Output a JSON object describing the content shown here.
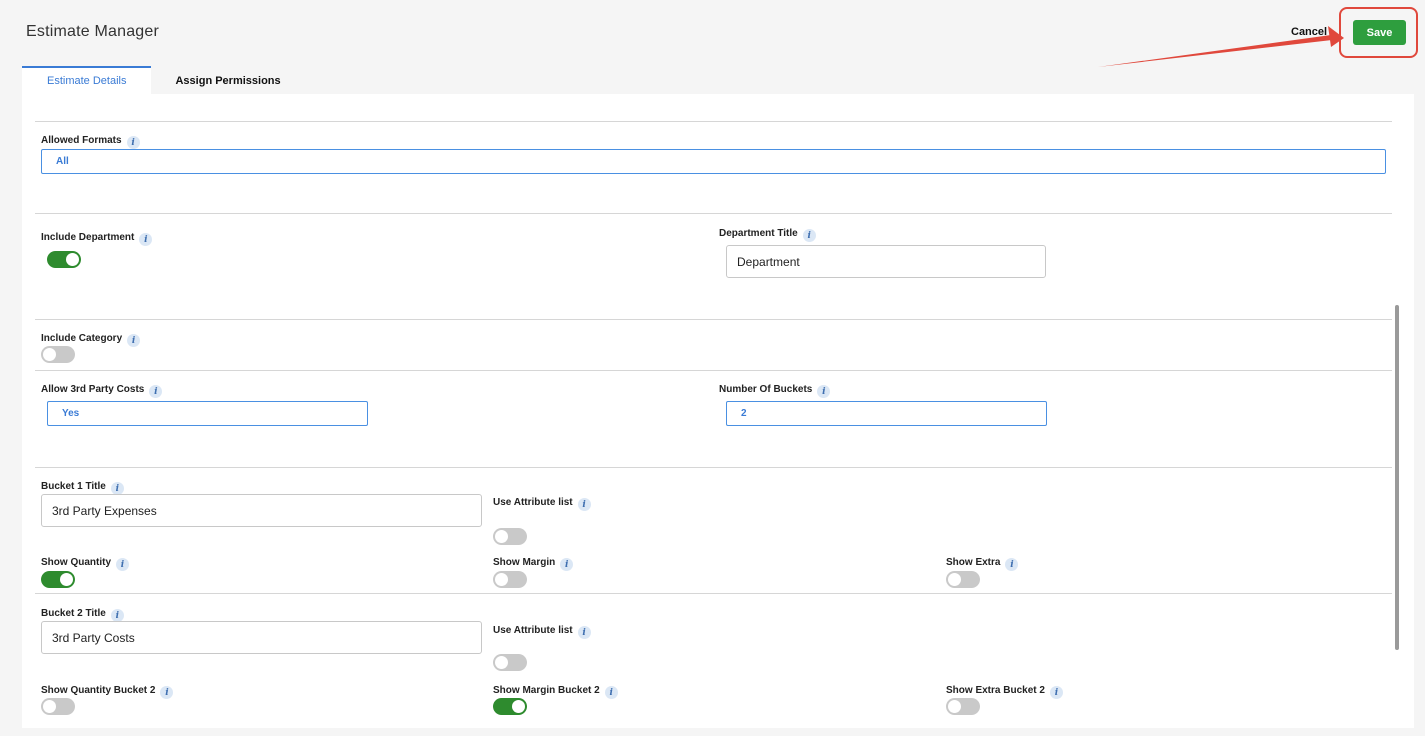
{
  "app": {
    "title": "Estimate Manager"
  },
  "header": {
    "cancel_label": "Cancel",
    "save_label": "Save"
  },
  "tabs": [
    {
      "label": "Estimate Details",
      "active": true
    },
    {
      "label": "Assign Permissions",
      "active": false
    }
  ],
  "form": {
    "allowed_formats": {
      "label": "Allowed Formats",
      "value": "All"
    },
    "include_department": {
      "label": "Include Department",
      "on": true
    },
    "department_title": {
      "label": "Department Title",
      "value": "Department"
    },
    "include_category": {
      "label": "Include Category",
      "on": false
    },
    "allow_3rd_party_costs": {
      "label": "Allow 3rd Party Costs",
      "value": "Yes"
    },
    "number_of_buckets": {
      "label": "Number Of Buckets",
      "value": "2"
    },
    "bucket1_title": {
      "label": "Bucket 1 Title",
      "value": "3rd Party Expenses"
    },
    "bucket1_use_attribute_list": {
      "label": "Use Attribute list",
      "on": false
    },
    "show_quantity": {
      "label": "Show Quantity",
      "on": true
    },
    "show_margin": {
      "label": "Show Margin",
      "on": false
    },
    "show_extra": {
      "label": "Show Extra",
      "on": false
    },
    "bucket2_title": {
      "label": "Bucket 2 Title",
      "value": "3rd Party Costs"
    },
    "bucket2_use_attribute_list": {
      "label": "Use Attribute list",
      "on": false
    },
    "show_quantity_bucket2": {
      "label": "Show Quantity Bucket 2",
      "on": false
    },
    "show_margin_bucket2": {
      "label": "Show Margin Bucket 2",
      "on": true
    },
    "show_extra_bucket2": {
      "label": "Show Extra Bucket 2",
      "on": false
    }
  },
  "icons": {
    "info": "info-icon",
    "arrow": "annotation-arrow"
  },
  "colors": {
    "accent": "#3a7bd5",
    "save": "#2e9e3e",
    "toggle_on": "#2e8b2e",
    "toggle_off": "#c9c9c9",
    "highlight": "#e0483c"
  },
  "info_glyph": "i"
}
